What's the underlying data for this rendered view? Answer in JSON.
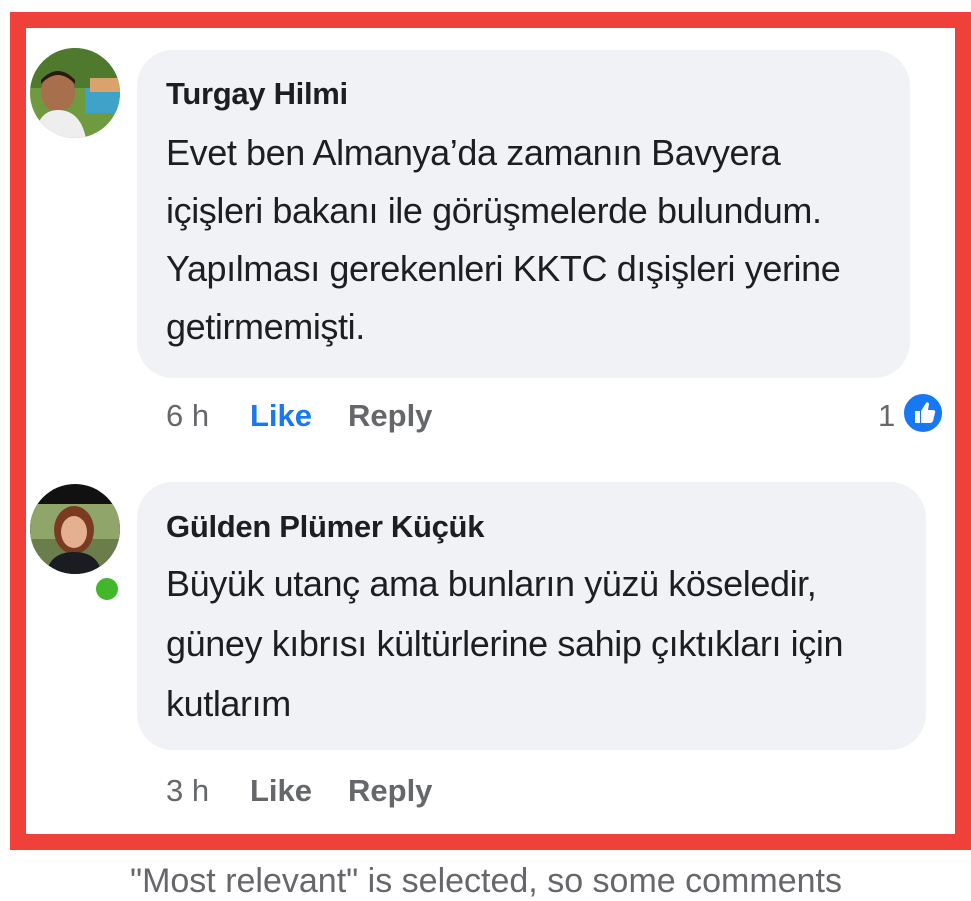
{
  "comments": [
    {
      "author": "Turgay Hilmi",
      "text_lines": [
        "Evet ben Almanya’da zamanın Bavyera",
        "içişleri bakanı ile görüşmelerde bulundum.",
        "Yapılması gerekenleri KKTC dışişleri yerine",
        "getirmemişti."
      ],
      "time": "6 h",
      "like_label": "Like",
      "reply_label": "Reply",
      "like_active": true,
      "reaction_count": "1",
      "reaction_icon": "thumbs-up-icon",
      "online": false
    },
    {
      "author": "Gülden Plümer Küçük",
      "text_lines": [
        "Büyük utanç ama bunların yüzü köseledir,",
        "güney kıbrısı kültürlerine sahip çıktıkları için",
        "kutlarım"
      ],
      "time": "3 h",
      "like_label": "Like",
      "reply_label": "Reply",
      "like_active": false,
      "online": true
    }
  ],
  "footer": {
    "note": "\"Most relevant\" is selected, so some comments"
  },
  "colors": {
    "frame": "#f0403a",
    "bubble": "#f0f2f5",
    "like_active": "#1877f2",
    "muted": "#65676b",
    "online": "#42b72a"
  }
}
